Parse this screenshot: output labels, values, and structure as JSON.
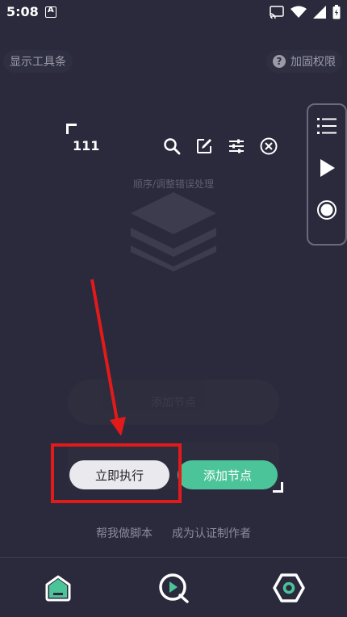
{
  "status": {
    "time": "5:08"
  },
  "top": {
    "show_toolbar": "显示工具条",
    "reinforce": "加固权限",
    "help_symbol": "?"
  },
  "script": {
    "name": "111",
    "hint": "顺序/调整错误处理",
    "ghost_pill": "添加节点"
  },
  "actions": {
    "execute_now": "立即执行",
    "add_node": "添加节点"
  },
  "links": {
    "help_write": "帮我做脚本",
    "become_author": "成为认证制作者"
  },
  "colors": {
    "background": "#2a2a3c",
    "accent_green": "#4cc49a",
    "highlight_red": "#e21a1a"
  },
  "icons": {
    "tools": [
      "search-icon",
      "edit-icon",
      "settings-sliders-icon",
      "close-circle-icon"
    ],
    "float_panel": [
      "list-icon",
      "play-icon",
      "record-icon"
    ],
    "bottom_nav": [
      "home-icon",
      "play-q-icon",
      "hex-settings-icon"
    ]
  }
}
